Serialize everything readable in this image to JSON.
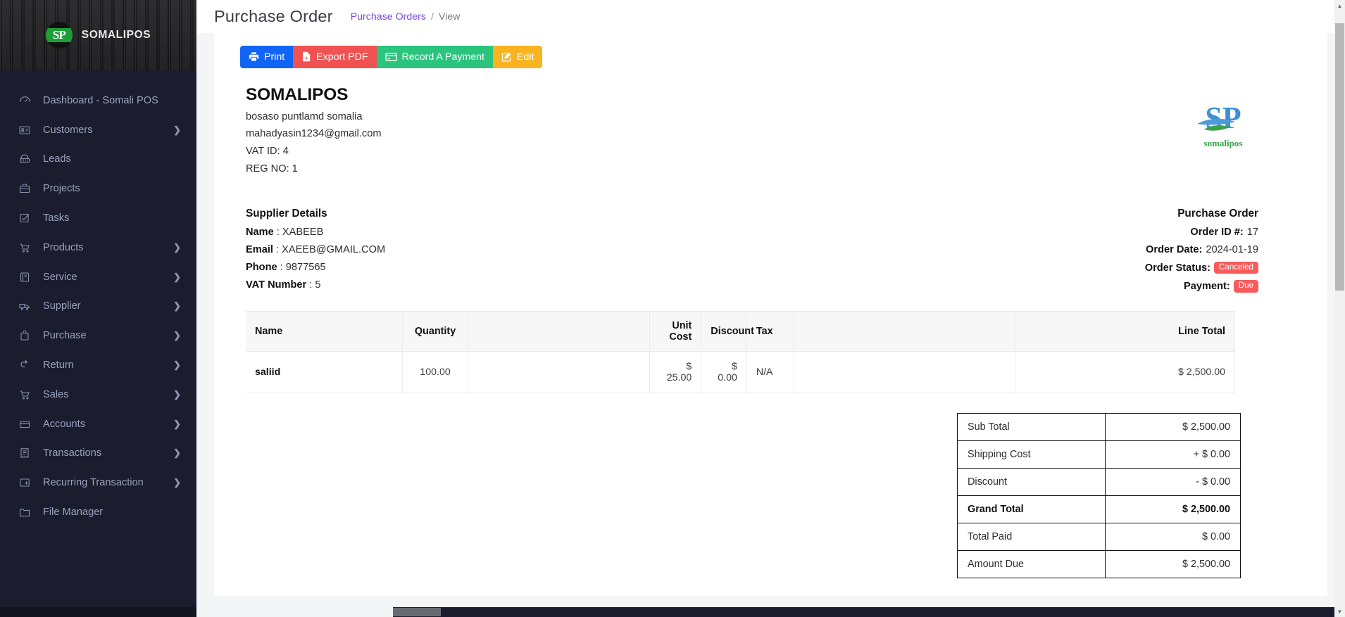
{
  "sidebar": {
    "brand": {
      "mark_text": "SP",
      "name": "SOMALIPOS"
    },
    "items": [
      {
        "label": "Dashboard - Somali POS",
        "icon": "speedometer-icon",
        "caret": ""
      },
      {
        "label": "Customers",
        "icon": "id-card-icon",
        "caret": "❯"
      },
      {
        "label": "Leads",
        "icon": "telephone-icon",
        "caret": ""
      },
      {
        "label": "Projects",
        "icon": "briefcase-icon",
        "caret": ""
      },
      {
        "label": "Tasks",
        "icon": "check-square-icon",
        "caret": ""
      },
      {
        "label": "Products",
        "icon": "cart-icon",
        "caret": "❯"
      },
      {
        "label": "Service",
        "icon": "book-icon",
        "caret": "❯"
      },
      {
        "label": "Supplier",
        "icon": "truck-icon",
        "caret": "❯"
      },
      {
        "label": "Purchase",
        "icon": "bag-icon",
        "caret": "❯"
      },
      {
        "label": "Return",
        "icon": "arrow-return-icon",
        "caret": "❯"
      },
      {
        "label": "Sales",
        "icon": "cart-icon",
        "caret": "❯"
      },
      {
        "label": "Accounts",
        "icon": "credit-card-icon",
        "caret": "❯"
      },
      {
        "label": "Transactions",
        "icon": "receipt-icon",
        "caret": "❯"
      },
      {
        "label": "Recurring Transaction",
        "icon": "recurring-icon",
        "caret": "❯"
      },
      {
        "label": "File Manager",
        "icon": "folder-icon",
        "caret": ""
      }
    ]
  },
  "header": {
    "title": "Purchase Order",
    "breadcrumb_link": "Purchase Orders",
    "breadcrumb_sep": "/",
    "breadcrumb_current": "View"
  },
  "toolbar": {
    "buttons": [
      {
        "label": "Print",
        "icon": "printer-icon",
        "color": "#1264f6"
      },
      {
        "label": "Export PDF",
        "icon": "pdf-file-icon",
        "color": "#f05252"
      },
      {
        "label": "Record A Payment",
        "icon": "card-payment-icon",
        "color": "#2bc47d"
      },
      {
        "label": "Edit",
        "icon": "pencil-square-icon",
        "color": "#f9b321"
      }
    ]
  },
  "company": {
    "name": "SOMALIPOS",
    "address": "bosaso puntlamd somalia",
    "email": "mahadyasin1234@gmail.com",
    "vat_id": "VAT ID: 4",
    "reg_no": "REG NO: 1",
    "logo_word": "somalipos",
    "logo_letters": "SP"
  },
  "supplier": {
    "heading": "Supplier Details",
    "rows": [
      {
        "label": "Name",
        "sep": " : ",
        "value": "XABEEB"
      },
      {
        "label": "Email",
        "sep": " : ",
        "value": "XAEEB@GMAIL.COM"
      },
      {
        "label": "Phone",
        "sep": " : ",
        "value": "9877565"
      },
      {
        "label": "VAT Number",
        "sep": " : ",
        "value": "5"
      }
    ]
  },
  "order": {
    "heading": "Purchase Order",
    "order_id_label": "Order ID #:",
    "order_id": "17",
    "order_date_label": "Order Date:",
    "order_date": "2024-01-19",
    "order_status_label": "Order Status:",
    "order_status": "Canceled",
    "payment_label": "Payment:",
    "payment": "Due",
    "status_color": "#f75c5c"
  },
  "items_table": {
    "columns": [
      "Name",
      "Quantity",
      "",
      "Unit Cost",
      "Discount",
      "Tax",
      "",
      "Line Total"
    ],
    "rows": [
      {
        "name": "saliid",
        "quantity": "100.00",
        "spacer1": "",
        "unit_cost": "$ 25.00",
        "discount": "$ 0.00",
        "tax": "N/A",
        "spacer2": "",
        "line_total": "$ 2,500.00"
      }
    ]
  },
  "totals": [
    {
      "label": "Sub Total",
      "value": "$ 2,500.00",
      "bold": false
    },
    {
      "label": "Shipping Cost",
      "value": "+ $ 0.00",
      "bold": false
    },
    {
      "label": "Discount",
      "value": "- $ 0.00",
      "bold": false
    },
    {
      "label": "Grand Total",
      "value": "$ 2,500.00",
      "bold": true
    },
    {
      "label": "Total Paid",
      "value": "$ 0.00",
      "bold": false
    },
    {
      "label": "Amount Due",
      "value": "$ 2,500.00",
      "bold": false
    }
  ]
}
